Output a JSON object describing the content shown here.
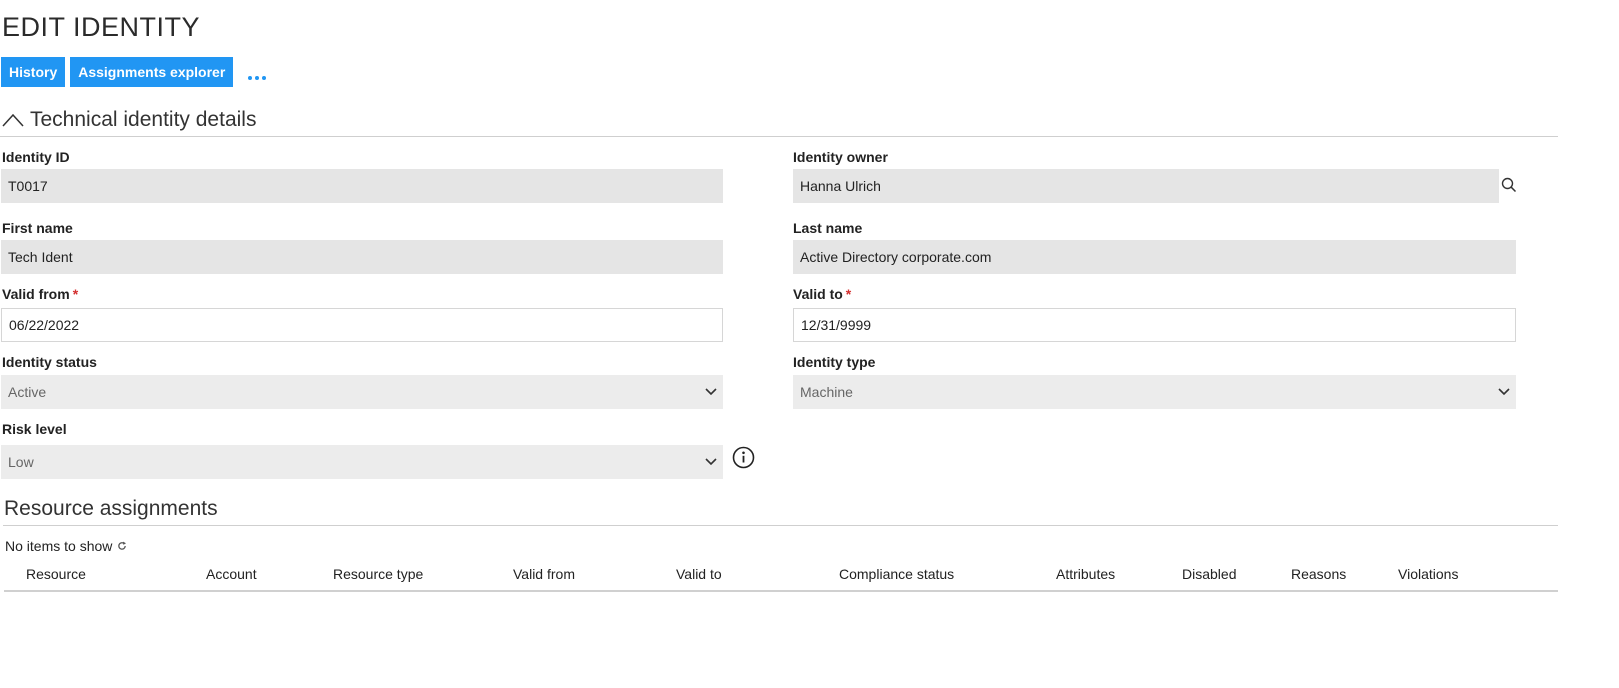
{
  "page": {
    "title": "EDIT IDENTITY"
  },
  "toolbar": {
    "history_label": "History",
    "assignments_label": "Assignments explorer"
  },
  "section1": {
    "title": "Technical identity details"
  },
  "fields": {
    "identity_id": {
      "label": "Identity ID",
      "value": "T0017"
    },
    "identity_owner": {
      "label": "Identity owner",
      "value": "Hanna Ulrich"
    },
    "first_name": {
      "label": "First name",
      "value": "Tech Ident"
    },
    "last_name": {
      "label": "Last name",
      "value": "Active Directory corporate.com"
    },
    "valid_from": {
      "label": "Valid from",
      "required_mark": "*",
      "value": "06/22/2022"
    },
    "valid_to": {
      "label": "Valid to",
      "required_mark": "*",
      "value": "12/31/9999"
    },
    "identity_status": {
      "label": "Identity status",
      "value": "Active"
    },
    "identity_type": {
      "label": "Identity type",
      "value": "Machine"
    },
    "risk_level": {
      "label": "Risk level",
      "value": "Low"
    }
  },
  "section2": {
    "title": "Resource assignments",
    "empty_text": "No items to show"
  },
  "table": {
    "columns": [
      "Resource",
      "Account",
      "Resource type",
      "Valid from",
      "Valid to",
      "Compliance status",
      "Attributes",
      "Disabled",
      "Reasons",
      "Violations"
    ]
  },
  "colors": {
    "accent": "#2196f3",
    "readonly_bg": "#e5e5e5",
    "required": "#d32f2f"
  }
}
